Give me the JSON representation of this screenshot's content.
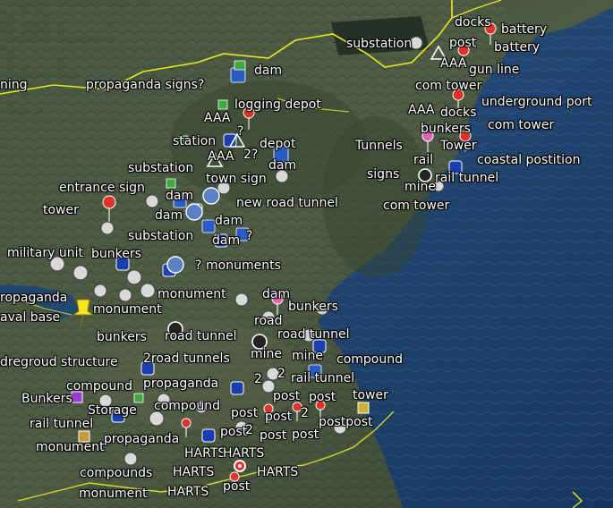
{
  "labels": {
    "l01": "docks",
    "l02": "battery",
    "l03": "substation",
    "l04": "post",
    "l05": "battery",
    "l06": "AAA",
    "l07": "gun line",
    "l08": "com tower",
    "l09": "underground port",
    "l10": "AAA",
    "l11": "docks",
    "l12": "com tower",
    "l13": "bunkers",
    "l14": "Tunnels",
    "l15": "Tower",
    "l16": "rail",
    "l17": "coastal postition",
    "l18": "signs",
    "l19": "rail tunnel",
    "l20": "mine",
    "l21": "com tower",
    "l22": "ning",
    "l23": "dam",
    "l24": "propaganda signs?",
    "l25": "logging depot",
    "l26": "AAA",
    "l27": "?",
    "l28": "station",
    "l29": "depot",
    "l30": "AAA",
    "l31": "2?",
    "l32": "dam",
    "l33": "substation",
    "l34": "town sign",
    "l35": "entrance sign",
    "l36": "dam",
    "l37": "new road tunnel",
    "l38": "tower",
    "l39": "dam",
    "l40": "dam",
    "l41": "substation",
    "l42": "dam",
    "l43": "?",
    "l44": "military unit",
    "l45": "bunkers",
    "l46": "?",
    "l47": "monuments",
    "l48": "ropaganda",
    "l49": "monument",
    "l50": "dam",
    "l51": "aval base",
    "l52": "monument",
    "l53": "bunkers",
    "l54": "road",
    "l55": "bunkers",
    "l56": "road tunnel",
    "l57": "road tunnel",
    "l58": "dregroud structure",
    "l59": "2road tunnels",
    "l60": "mine",
    "l61": "mine",
    "l62": "compound",
    "l63": "compound",
    "l64": "propaganda",
    "l65": "2",
    "l66": "2",
    "l67": "rail tunnel",
    "l68": "Bunkers",
    "l69": "Storage",
    "l70": "compound",
    "l71": "post",
    "l72": "post",
    "l73": "tower",
    "l74": "rail tunnel",
    "l75": "post",
    "l76": "post",
    "l77": "2",
    "l78": "postpost",
    "l79": "propaganda",
    "l80": "post",
    "l81": "2",
    "l82": "post",
    "l83": "post",
    "l84": "monument",
    "l85": "HARTS",
    "l86": "HARTS",
    "l87": "compounds",
    "l88": "HARTS",
    "l89": "HARTS",
    "l90": "monument",
    "l91": "HARTS",
    "l92": "post"
  },
  "colors": {
    "sea": "#1d3f6b",
    "land": "#4e5a42",
    "border": "#e8e82a"
  },
  "icons": [
    "dam-icon",
    "aaa-icon",
    "tower-icon",
    "tunnel-icon",
    "pushpin-icon",
    "question-icon"
  ]
}
